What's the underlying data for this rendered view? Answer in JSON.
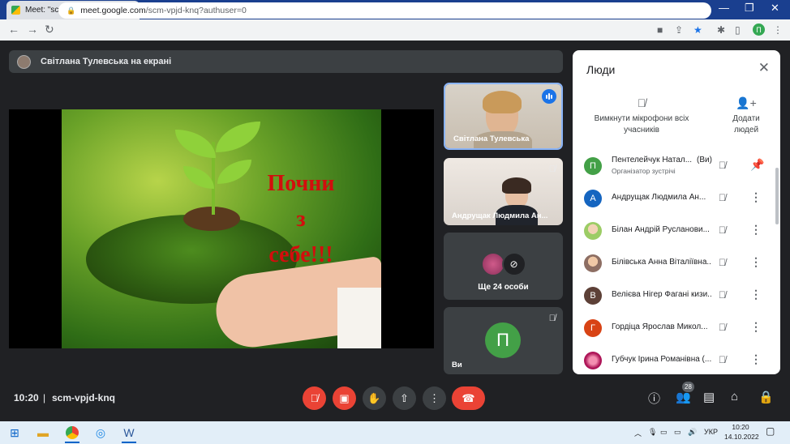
{
  "browser": {
    "tab_title": "Meet: \"scm-vpjd-knq\"",
    "tab_close": "✕",
    "new_tab": "+",
    "url_host": "meet.google.com",
    "url_path": "/scm-vpjd-knq?authuser=0",
    "profile_initial": "П"
  },
  "meet": {
    "presenter_banner": "Світлана Тулевська на екрані",
    "slide_text_1": "Почни",
    "slide_text_2": "з",
    "slide_text_3": "себе!!!",
    "tiles": [
      {
        "name": "Світлана Тулевська"
      },
      {
        "name": "Андрущак Людмила Ан..."
      },
      {
        "name": "Ще 24 особи"
      },
      {
        "name": "Ви",
        "initial": "П"
      }
    ]
  },
  "people_panel": {
    "title": "Люди",
    "mute_all_label_1": "Вимкнути мікрофони всіх",
    "mute_all_label_2": "учасників",
    "add_people_label_1": "Додати",
    "add_people_label_2": "людей",
    "participants": [
      {
        "initial": "П",
        "name": "Пентелейчук Натал...",
        "you": "(Ви)",
        "role": "Організатор зустрічі",
        "color": "#43a047"
      },
      {
        "initial": "А",
        "name": "Андрущак Людмила Ан...",
        "color": "#1565c0"
      },
      {
        "initial": "",
        "name": "Білан Андрій Русланови...",
        "color": "#9ccc65"
      },
      {
        "initial": "",
        "name": "Білівська Анна Віталіївна...",
        "color": "#c9a27c"
      },
      {
        "initial": "В",
        "name": "Велієва Нігер Фагані кизи...",
        "color": "#5d4037"
      },
      {
        "initial": "Г",
        "name": "Гордіца Ярослав Микол...",
        "color": "#d84315"
      },
      {
        "initial": "",
        "name": "Губчук Ірина Романівна (...",
        "color": "#ad1457"
      }
    ]
  },
  "bottom_bar": {
    "time": "10:20",
    "separator": "|",
    "meeting_code": "scm-vpjd-knq",
    "people_count": "28"
  },
  "taskbar": {
    "language": "УКР",
    "clock_time": "10:20",
    "clock_date": "14.10.2022"
  },
  "colors": {
    "meet_bg": "#202124",
    "tile_bg": "#3c4043",
    "danger": "#ea4335",
    "accent": "#1a73e8",
    "tab_strip": "#1a3f8f"
  }
}
